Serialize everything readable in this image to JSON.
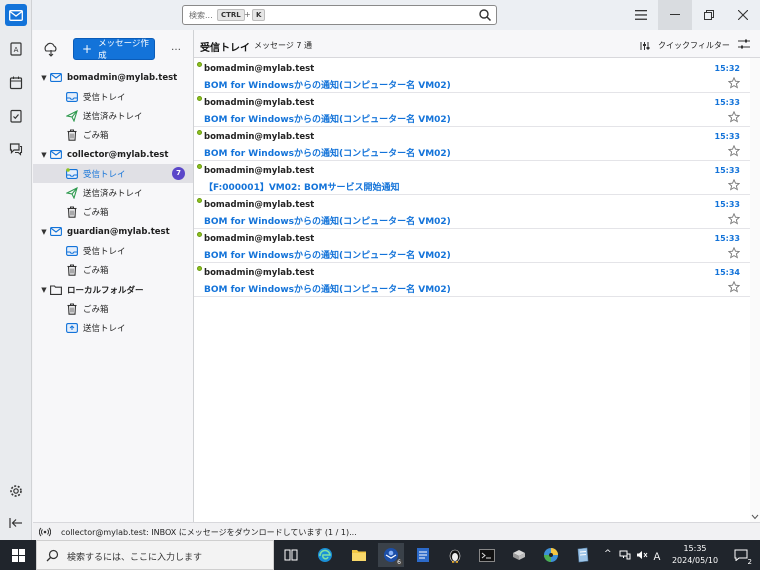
{
  "search": {
    "placeholder": "検索...",
    "key1": "CTRL",
    "plus": "+",
    "key2": "K"
  },
  "folder_pane": {
    "write_button": "メッセージ作成",
    "more": "…",
    "items": [
      {
        "label": "bomadmin@mylab.test",
        "type": "account"
      },
      {
        "label": "受信トレイ",
        "type": "inbox"
      },
      {
        "label": "送信済みトレイ",
        "type": "sent"
      },
      {
        "label": "ごみ箱",
        "type": "trash"
      },
      {
        "label": "collector@mylab.test",
        "type": "account"
      },
      {
        "label": "受信トレイ",
        "type": "inbox",
        "selected": true,
        "badge": "7"
      },
      {
        "label": "送信済みトレイ",
        "type": "sent"
      },
      {
        "label": "ごみ箱",
        "type": "trash"
      },
      {
        "label": "guardian@mylab.test",
        "type": "account"
      },
      {
        "label": "受信トレイ",
        "type": "inbox"
      },
      {
        "label": "ごみ箱",
        "type": "trash"
      },
      {
        "label": "ローカルフォルダー",
        "type": "local"
      },
      {
        "label": "ごみ箱",
        "type": "trash"
      },
      {
        "label": "送信トレイ",
        "type": "outbox"
      }
    ]
  },
  "thread_pane": {
    "title": "受信トレイ",
    "count": "メッセージ 7 通",
    "quick_filter": "クイックフィルター",
    "messages": [
      {
        "sender": "bomadmin@mylab.test",
        "subject": "BOM for Windowsからの通知(コンピューター名 VM02)",
        "time": "15:32"
      },
      {
        "sender": "bomadmin@mylab.test",
        "subject": "BOM for Windowsからの通知(コンピューター名 VM02)",
        "time": "15:33"
      },
      {
        "sender": "bomadmin@mylab.test",
        "subject": "BOM for Windowsからの通知(コンピューター名 VM02)",
        "time": "15:33"
      },
      {
        "sender": "bomadmin@mylab.test",
        "subject": "【F:000001】VM02: BOMサービス開始通知",
        "time": "15:33"
      },
      {
        "sender": "bomadmin@mylab.test",
        "subject": "BOM for Windowsからの通知(コンピューター名 VM02)",
        "time": "15:33"
      },
      {
        "sender": "bomadmin@mylab.test",
        "subject": "BOM for Windowsからの通知(コンピューター名 VM02)",
        "time": "15:33"
      },
      {
        "sender": "bomadmin@mylab.test",
        "subject": "BOM for Windowsからの通知(コンピューター名 VM02)",
        "time": "15:34"
      }
    ]
  },
  "status_bar": {
    "text": "collector@mylab.test: INBOX にメッセージをダウンロードしています (1 / 1)..."
  },
  "taskbar": {
    "search_placeholder": "検索するには、ここに入力します",
    "time": "15:35",
    "date": "2024/05/10",
    "notification_count": "2",
    "edge_badge": "6"
  },
  "colors": {
    "accent": "#1373d9",
    "badge": "#5b47c9",
    "unread_dot": "#8fc31f"
  }
}
